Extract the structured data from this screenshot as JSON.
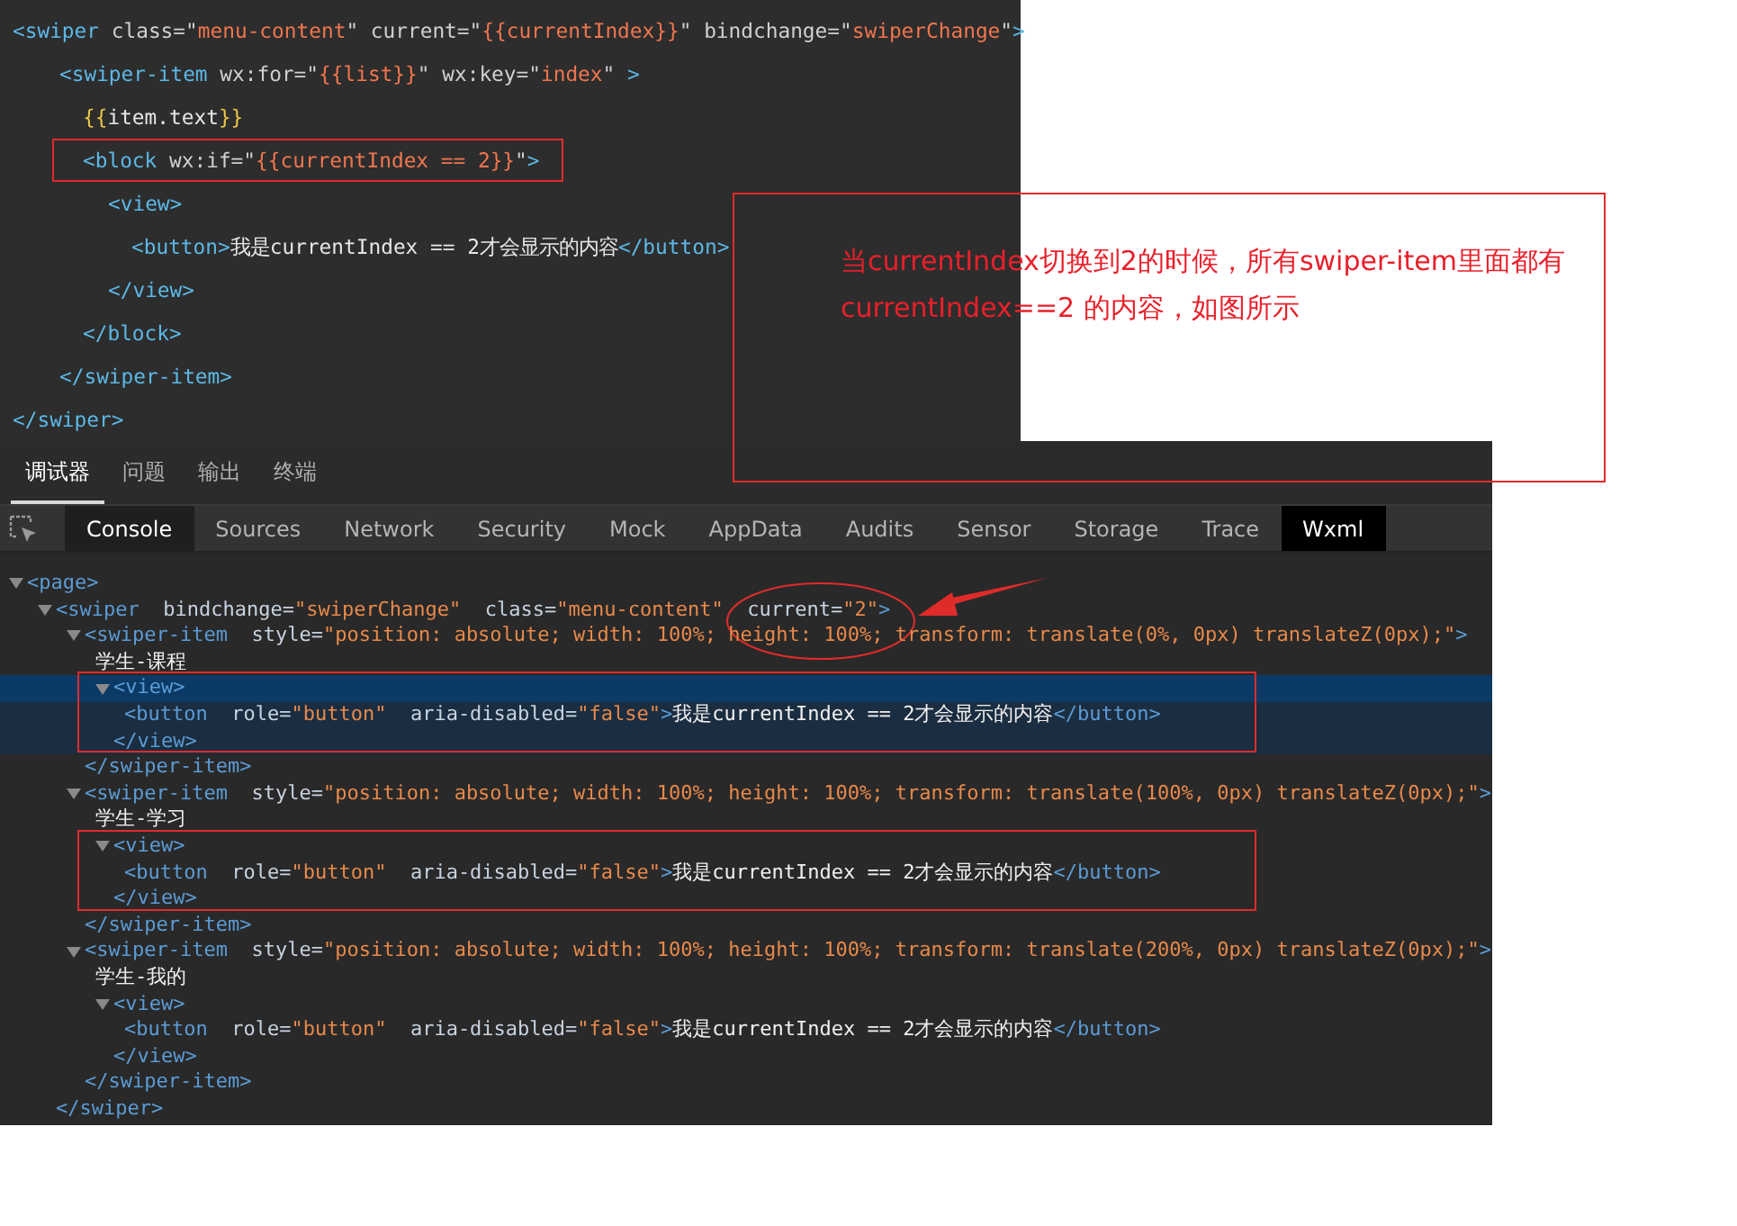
{
  "editor": {
    "lines": [
      {
        "segments": [
          {
            "kind": "tag",
            "text": "<swiper"
          },
          {
            "kind": "attr",
            "text": " class=\""
          },
          {
            "kind": "string",
            "text": "menu-content"
          },
          {
            "kind": "attr",
            "text": "\" current=\""
          },
          {
            "kind": "string",
            "text": "{{currentIndex}}"
          },
          {
            "kind": "attr",
            "text": "\" bindchange=\""
          },
          {
            "kind": "string",
            "text": "swiperChange"
          },
          {
            "kind": "attr",
            "text": "\""
          },
          {
            "kind": "tag",
            "text": ">"
          }
        ],
        "children": [
          {
            "segments": [
              {
                "kind": "tag",
                "text": "<swiper-item"
              },
              {
                "kind": "attr",
                "text": " wx:for=\""
              },
              {
                "kind": "string",
                "text": "{{list}}"
              },
              {
                "kind": "attr",
                "text": "\" wx:key=\""
              },
              {
                "kind": "string",
                "text": "index"
              },
              {
                "kind": "attr",
                "text": "\" "
              },
              {
                "kind": "tag",
                "text": ">"
              }
            ],
            "children": [
              {
                "segments": [
                  {
                    "kind": "brace",
                    "text": "{{"
                  },
                  {
                    "kind": "text",
                    "text": "item.text"
                  },
                  {
                    "kind": "brace",
                    "text": "}}"
                  }
                ]
              },
              {
                "outlined": true,
                "segments": [
                  {
                    "kind": "tag",
                    "text": "<block"
                  },
                  {
                    "kind": "attr",
                    "text": " wx:if=\""
                  },
                  {
                    "kind": "string",
                    "text": "{{currentIndex == 2}}"
                  },
                  {
                    "kind": "attr",
                    "text": "\""
                  },
                  {
                    "kind": "tag",
                    "text": ">"
                  }
                ],
                "children": [
                  {
                    "segments": [
                      {
                        "kind": "tag",
                        "text": "<view>"
                      }
                    ],
                    "children": [
                      {
                        "segments": [
                          {
                            "kind": "tag",
                            "text": "<button>"
                          },
                          {
                            "kind": "text",
                            "text": "我是currentIndex == 2才会显示的内容"
                          },
                          {
                            "kind": "tag",
                            "text": "</button>"
                          }
                        ]
                      }
                    ],
                    "close": [
                      {
                        "kind": "tag",
                        "text": "</view>"
                      }
                    ]
                  }
                ],
                "close": [
                  {
                    "kind": "tag",
                    "text": "</block>"
                  }
                ]
              }
            ],
            "close": [
              {
                "kind": "tag",
                "text": "</swiper-item>"
              }
            ]
          }
        ],
        "close": [
          {
            "kind": "tag",
            "text": "</swiper>"
          }
        ]
      }
    ]
  },
  "annotation": {
    "lines": [
      "当currentIndex切换到2的时候，所有swiper-item里面都有",
      "currentIndex==2 的内容，如图所示"
    ]
  },
  "devtools": {
    "panel_tabs": [
      {
        "label": "调试器",
        "selected": true
      },
      {
        "label": "问题",
        "selected": false
      },
      {
        "label": "输出",
        "selected": false
      },
      {
        "label": "终端",
        "selected": false
      }
    ],
    "tool_tabs": [
      {
        "label": "Console",
        "selected": false,
        "hovered": true
      },
      {
        "label": "Sources",
        "selected": false,
        "hovered": false
      },
      {
        "label": "Network",
        "selected": false,
        "hovered": false
      },
      {
        "label": "Security",
        "selected": false,
        "hovered": false
      },
      {
        "label": "Mock",
        "selected": false,
        "hovered": false
      },
      {
        "label": "AppData",
        "selected": false,
        "hovered": false
      },
      {
        "label": "Audits",
        "selected": false,
        "hovered": false
      },
      {
        "label": "Sensor",
        "selected": false,
        "hovered": false
      },
      {
        "label": "Storage",
        "selected": false,
        "hovered": false
      },
      {
        "label": "Trace",
        "selected": false,
        "hovered": false
      },
      {
        "label": "Wxml",
        "selected": true,
        "hovered": false
      }
    ],
    "tree": [
      {
        "selected": false,
        "expanded": true,
        "segments": [
          {
            "kind": "tag",
            "text": "<page>"
          }
        ],
        "children": [
          {
            "selected": false,
            "expanded": true,
            "segments": [
              {
                "kind": "tag",
                "text": "<swiper"
              },
              {
                "kind": "attr",
                "text": "  bindchange="
              },
              {
                "kind": "string",
                "text": "\"swiperChange\""
              },
              {
                "kind": "attr",
                "text": "  class="
              },
              {
                "kind": "string",
                "text": "\"menu-content\""
              },
              {
                "kind": "attr",
                "text": "  current=",
                "circled": true
              },
              {
                "kind": "string",
                "text": "\"2\""
              },
              {
                "kind": "tag",
                "text": ">"
              }
            ],
            "children": [
              {
                "selected": false,
                "expanded": true,
                "segments": [
                  {
                    "kind": "tag",
                    "text": "<swiper-item"
                  },
                  {
                    "kind": "attr",
                    "text": "  style="
                  },
                  {
                    "kind": "string",
                    "text": "\"position: absolute; width: 100%; height: 100%; transform: translate(0%, 0px) translateZ(0px);\""
                  },
                  {
                    "kind": "tag",
                    "text": ">"
                  }
                ],
                "children": [
                  {
                    "selected": false,
                    "segments": [
                      {
                        "kind": "text",
                        "text": "学生-课程"
                      }
                    ]
                  },
                  {
                    "selected": true,
                    "expanded": true,
                    "outlined": true,
                    "segments": [
                      {
                        "kind": "tag",
                        "text": "<view>"
                      }
                    ],
                    "children": [
                      {
                        "selected": false,
                        "segments": [
                          {
                            "kind": "tag",
                            "text": "<button"
                          },
                          {
                            "kind": "attr",
                            "text": "  role="
                          },
                          {
                            "kind": "string",
                            "text": "\"button\""
                          },
                          {
                            "kind": "attr",
                            "text": "  aria-disabled="
                          },
                          {
                            "kind": "string",
                            "text": "\"false\""
                          },
                          {
                            "kind": "tag",
                            "text": ">"
                          },
                          {
                            "kind": "text",
                            "text": "我是currentIndex == 2才会显示的内容"
                          },
                          {
                            "kind": "tag",
                            "text": "</button>"
                          }
                        ]
                      }
                    ],
                    "close": [
                      {
                        "kind": "tag",
                        "text": "</view>"
                      }
                    ]
                  }
                ],
                "close": [
                  {
                    "kind": "tag",
                    "text": "</swiper-item>"
                  }
                ]
              },
              {
                "selected": false,
                "expanded": true,
                "segments": [
                  {
                    "kind": "tag",
                    "text": "<swiper-item"
                  },
                  {
                    "kind": "attr",
                    "text": "  style="
                  },
                  {
                    "kind": "string",
                    "text": "\"position: absolute; width: 100%; height: 100%; transform: translate(100%, 0px) translateZ(0px);\""
                  },
                  {
                    "kind": "tag",
                    "text": ">"
                  }
                ],
                "children": [
                  {
                    "selected": false,
                    "segments": [
                      {
                        "kind": "text",
                        "text": "学生-学习"
                      }
                    ]
                  },
                  {
                    "selected": false,
                    "expanded": true,
                    "outlined": true,
                    "segments": [
                      {
                        "kind": "tag",
                        "text": "<view>"
                      }
                    ],
                    "children": [
                      {
                        "selected": false,
                        "segments": [
                          {
                            "kind": "tag",
                            "text": "<button"
                          },
                          {
                            "kind": "attr",
                            "text": "  role="
                          },
                          {
                            "kind": "string",
                            "text": "\"button\""
                          },
                          {
                            "kind": "attr",
                            "text": "  aria-disabled="
                          },
                          {
                            "kind": "string",
                            "text": "\"false\""
                          },
                          {
                            "kind": "tag",
                            "text": ">"
                          },
                          {
                            "kind": "text",
                            "text": "我是currentIndex == 2才会显示的内容"
                          },
                          {
                            "kind": "tag",
                            "text": "</button>"
                          }
                        ]
                      }
                    ],
                    "close": [
                      {
                        "kind": "tag",
                        "text": "</view>"
                      }
                    ]
                  }
                ],
                "close": [
                  {
                    "kind": "tag",
                    "text": "</swiper-item>"
                  }
                ]
              },
              {
                "selected": false,
                "expanded": true,
                "segments": [
                  {
                    "kind": "tag",
                    "text": "<swiper-item"
                  },
                  {
                    "kind": "attr",
                    "text": "  style="
                  },
                  {
                    "kind": "string",
                    "text": "\"position: absolute; width: 100%; height: 100%; transform: translate(200%, 0px) translateZ(0px);\""
                  },
                  {
                    "kind": "tag",
                    "text": ">"
                  }
                ],
                "children": [
                  {
                    "selected": false,
                    "segments": [
                      {
                        "kind": "text",
                        "text": "学生-我的"
                      }
                    ]
                  },
                  {
                    "selected": false,
                    "expanded": true,
                    "outlined": false,
                    "segments": [
                      {
                        "kind": "tag",
                        "text": "<view>"
                      }
                    ],
                    "children": [
                      {
                        "selected": false,
                        "segments": [
                          {
                            "kind": "tag",
                            "text": "<button"
                          },
                          {
                            "kind": "attr",
                            "text": "  role="
                          },
                          {
                            "kind": "string",
                            "text": "\"button\""
                          },
                          {
                            "kind": "attr",
                            "text": "  aria-disabled="
                          },
                          {
                            "kind": "string",
                            "text": "\"false\""
                          },
                          {
                            "kind": "tag",
                            "text": ">"
                          },
                          {
                            "kind": "text",
                            "text": "我是currentIndex == 2才会显示的内容"
                          },
                          {
                            "kind": "tag",
                            "text": "</button>"
                          }
                        ]
                      }
                    ],
                    "close": [
                      {
                        "kind": "tag",
                        "text": "</view>"
                      }
                    ]
                  }
                ],
                "close": [
                  {
                    "kind": "tag",
                    "text": "</swiper-item>"
                  }
                ]
              }
            ],
            "close": [
              {
                "kind": "tag",
                "text": "</swiper>"
              }
            ]
          }
        ]
      }
    ]
  }
}
